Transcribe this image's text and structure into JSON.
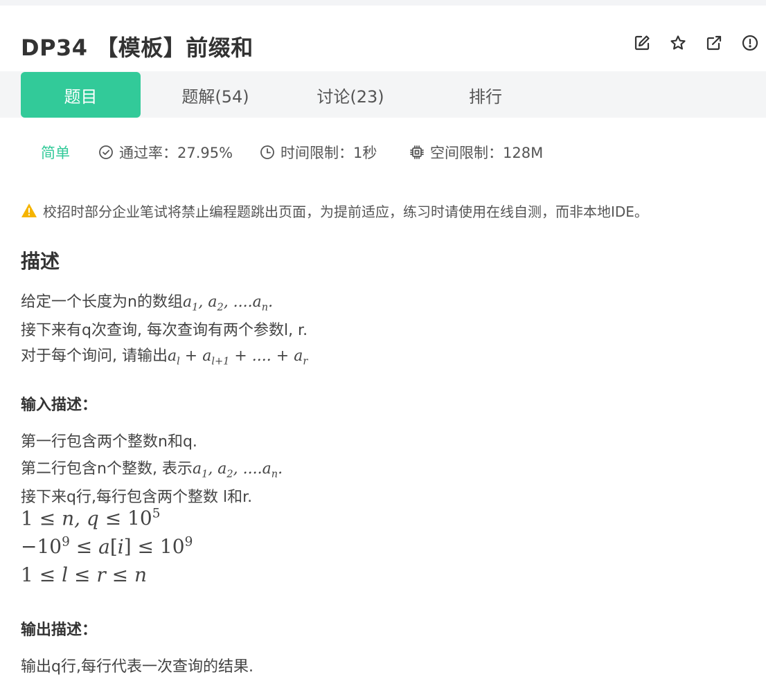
{
  "problem": {
    "title": "DP34  【模板】前缀和"
  },
  "actions": [
    {
      "name": "edit-icon"
    },
    {
      "name": "star-icon"
    },
    {
      "name": "share-icon"
    },
    {
      "name": "report-icon"
    }
  ],
  "tabs": [
    {
      "label": "题目",
      "active": true
    },
    {
      "label": "题解(54)"
    },
    {
      "label": "讨论(23)"
    },
    {
      "label": "排行"
    }
  ],
  "meta": {
    "difficulty": "简单",
    "pass_rate": "通过率：27.95%",
    "time_limit": "时间限制：1秒",
    "memory_limit": "空间限制：128M"
  },
  "warning": "校招时部分企业笔试将禁止编程题跳出页面，为提前适应，练习时请使用在线自测，而非本地IDE。",
  "description": {
    "heading": "描述",
    "line1_text": "给定一个长度为n的数组",
    "line2_text": "接下来有q次查询, 每次查询有两个参数l, r.",
    "line3_text": "对于每个询问, 请输出"
  },
  "input": {
    "heading": "输入描述：",
    "line1": "第一行包含两个整数n和q.",
    "line2_text": "第二行包含n个整数, 表示",
    "line3": "接下来q行,每行包含两个整数   l和r."
  },
  "output": {
    "heading": "输出描述：",
    "line1": "输出q行,每行代表一次查询的结果."
  },
  "theme": {
    "accent": "#32ca99",
    "warning": "#f5b400"
  }
}
